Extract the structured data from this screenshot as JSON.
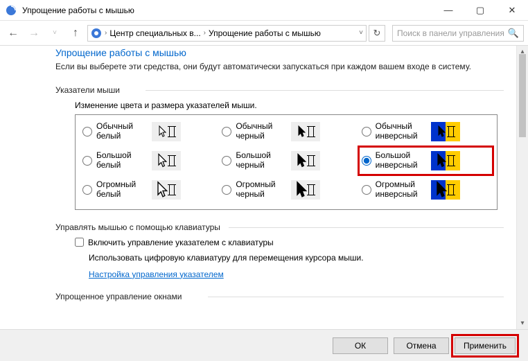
{
  "window": {
    "title": "Упрощение работы с мышью"
  },
  "breadcrumb": {
    "root": "Центр специальных в...",
    "current": "Упрощение работы с мышью"
  },
  "search": {
    "placeholder": "Поиск в панели управления"
  },
  "page": {
    "heading": "Упрощение работы с мышью",
    "description": "Если вы выберете эти средства, они будут автоматически запускаться при каждом вашем входе в систему."
  },
  "pointers": {
    "section": "Указатели мыши",
    "caption": "Изменение цвета и размера указателей мыши.",
    "options": [
      {
        "id": "white-normal",
        "label": "Обычный белый"
      },
      {
        "id": "black-normal",
        "label": "Обычный черный"
      },
      {
        "id": "inverse-normal",
        "label": "Обычный инверсный"
      },
      {
        "id": "white-large",
        "label": "Большой белый"
      },
      {
        "id": "black-large",
        "label": "Большой черный"
      },
      {
        "id": "inverse-large",
        "label": "Большой инверсный",
        "selected": true
      },
      {
        "id": "white-huge",
        "label": "Огромный белый"
      },
      {
        "id": "black-huge",
        "label": "Огромный черный"
      },
      {
        "id": "inverse-huge",
        "label": "Огромный инверсный"
      }
    ]
  },
  "keyboard_mouse": {
    "section": "Управлять мышью с помощью клавиатуры",
    "checkbox": "Включить управление указателем с клавиатуры",
    "description": "Использовать цифровую клавиатуру для перемещения курсора мыши.",
    "link": "Настройка управления указателем"
  },
  "windows_mgmt": {
    "section": "Упрощенное управление окнами"
  },
  "buttons": {
    "ok": "ОК",
    "cancel": "Отмена",
    "apply": "Применить"
  }
}
